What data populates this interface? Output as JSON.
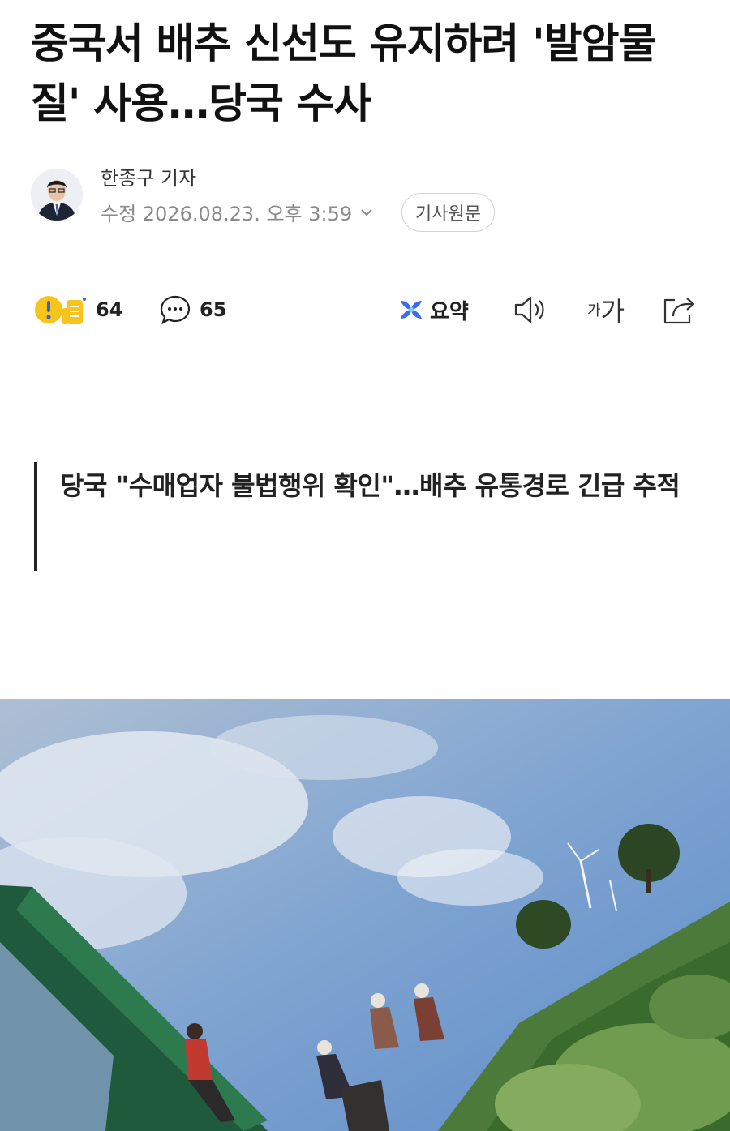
{
  "article": {
    "headline": "중국서 배추 신선도 유지하려 '발암물질' 사용…당국 수사",
    "reporter": "한종구 기자",
    "updated": "수정 2026.08.23. 오후 3:59",
    "original_button": "기사원문"
  },
  "actions": {
    "reaction_count": "64",
    "comment_count": "65",
    "summary_label": "요약",
    "fontsize_small": "가",
    "fontsize_large": "가"
  },
  "subheadline": "당국 \"수매업자 불법행위 확인\"…배추 유통경로 긴급 추적",
  "icons": {
    "reaction": "reaction-icon",
    "comment": "comment-bubble-icon",
    "summary": "ai-summary-icon",
    "audio": "speaker-icon",
    "fontsize": "font-size-icon",
    "share": "share-icon",
    "chevron": "chevron-down-icon"
  },
  "colors": {
    "accent_blue": "#3b6cf0",
    "reaction_yellow": "#f6c41a",
    "meta_gray": "#8a8a8a"
  }
}
